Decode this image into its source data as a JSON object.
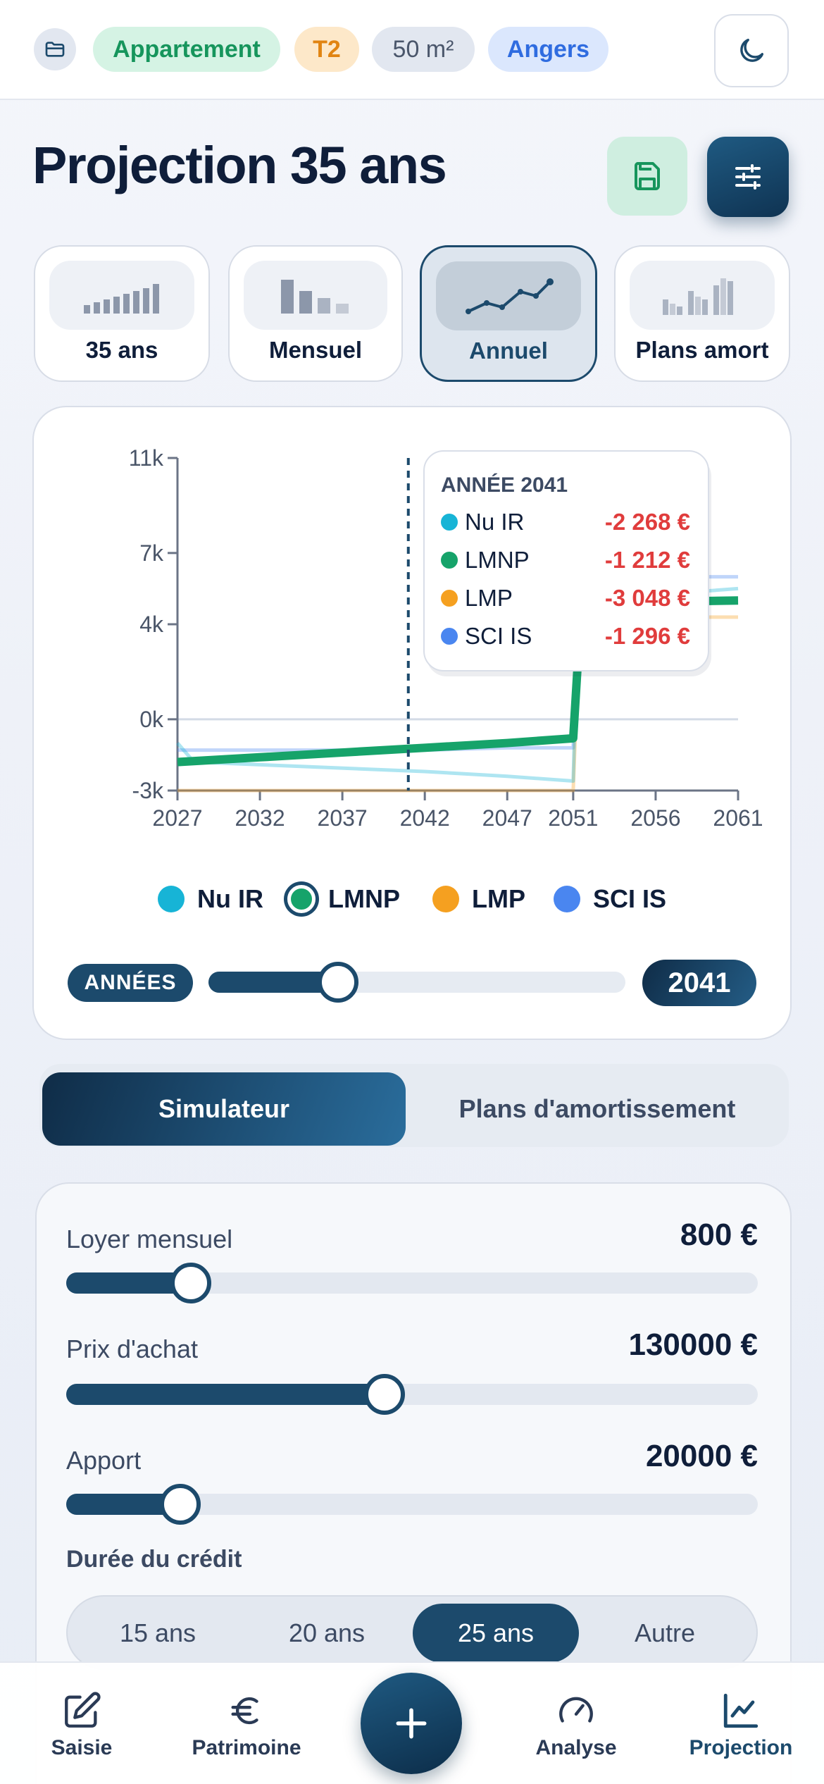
{
  "header": {
    "chips": {
      "type": "Appartement",
      "rooms": "T2",
      "surface": "50 m²",
      "city": "Angers"
    },
    "icons": {
      "folder": "folder-icon",
      "theme": "moon-icon"
    }
  },
  "page": {
    "title": "Projection 35 ans",
    "save_icon": "save-icon",
    "settings_icon": "sliders-icon"
  },
  "view_tabs": [
    {
      "label": "35 ans",
      "active": false
    },
    {
      "label": "Mensuel",
      "active": false
    },
    {
      "label": "Annuel",
      "active": true
    },
    {
      "label": "Plans amort",
      "active": false
    }
  ],
  "chart_data": {
    "type": "line",
    "x": [
      2027,
      2032,
      2037,
      2042,
      2047,
      2051,
      2056,
      2061
    ],
    "xticks": [
      "2027",
      "2032",
      "2037",
      "2042",
      "2047",
      "2051",
      "2056",
      "2061"
    ],
    "yticks": [
      "11k",
      "7k",
      "4k",
      "0k",
      "-3k"
    ],
    "ylim": [
      -3,
      11
    ],
    "xlim": [
      2027,
      2061
    ],
    "marker_year": 2041,
    "series": [
      {
        "name": "Nu IR",
        "color": "#17b4d6",
        "points": [
          [
            2027,
            -1.0
          ],
          [
            2028,
            -1.8
          ],
          [
            2035,
            -2.0
          ],
          [
            2042,
            -2.2
          ],
          [
            2047,
            -2.4
          ],
          [
            2051,
            -2.6
          ],
          [
            2051.3,
            5.0
          ],
          [
            2061,
            5.5
          ]
        ]
      },
      {
        "name": "LMNP",
        "color": "#16a36a",
        "points": [
          [
            2027,
            -1.8
          ],
          [
            2032,
            -1.6
          ],
          [
            2037,
            -1.4
          ],
          [
            2042,
            -1.2
          ],
          [
            2047,
            -1.0
          ],
          [
            2051,
            -0.8
          ],
          [
            2051.5,
            4.9
          ],
          [
            2061,
            5.0
          ]
        ]
      },
      {
        "name": "LMP",
        "color": "#f5a020",
        "points": [
          [
            2027,
            -3.0
          ],
          [
            2032,
            -3.0
          ],
          [
            2037,
            -3.0
          ],
          [
            2042,
            -3.0
          ],
          [
            2047,
            -3.0
          ],
          [
            2051,
            -3.0
          ],
          [
            2051.4,
            4.3
          ],
          [
            2061,
            4.3
          ]
        ]
      },
      {
        "name": "SCI IS",
        "color": "#4a86f0",
        "points": [
          [
            2027,
            -1.3
          ],
          [
            2032,
            -1.3
          ],
          [
            2037,
            -1.3
          ],
          [
            2042,
            -1.3
          ],
          [
            2047,
            -1.2
          ],
          [
            2051,
            -1.2
          ],
          [
            2051.3,
            6.0
          ],
          [
            2061,
            6.0
          ]
        ]
      }
    ],
    "tooltip": {
      "title": "ANNÉE 2041",
      "rows": [
        {
          "name": "Nu IR",
          "value": "-2 268 €",
          "color": "#17b4d6"
        },
        {
          "name": "LMNP",
          "value": "-1 212 €",
          "color": "#16a36a"
        },
        {
          "name": "LMP",
          "value": "-3 048 €",
          "color": "#f5a020"
        },
        {
          "name": "SCI IS",
          "value": "-1 296 €",
          "color": "#4a86f0"
        }
      ],
      "value_color": "#e03c3c"
    },
    "legend": [
      "Nu IR",
      "LMNP",
      "LMP",
      "SCI IS"
    ]
  },
  "years_slider": {
    "label": "ANNÉES",
    "value": "2041",
    "fraction": 0.31
  },
  "segment": {
    "active": "Simulateur",
    "inactive": "Plans d'amortissement"
  },
  "simulator": {
    "rent": {
      "label": "Loyer mensuel",
      "value": "800 €",
      "fraction": 0.18
    },
    "price": {
      "label": "Prix d'achat",
      "value": "130000 €",
      "fraction": 0.46
    },
    "down": {
      "label": "Apport",
      "value": "20000 €",
      "fraction": 0.165
    },
    "duration": {
      "label": "Durée du crédit",
      "options": [
        "15 ans",
        "20 ans",
        "25 ans",
        "Autre"
      ],
      "selected": "25 ans"
    }
  },
  "nav": {
    "items": [
      {
        "label": "Saisie",
        "icon": "edit-icon"
      },
      {
        "label": "Patrimoine",
        "icon": "euro-icon"
      },
      {
        "label": "Analyse",
        "icon": "gauge-icon"
      },
      {
        "label": "Projection",
        "icon": "chart-line-icon"
      }
    ],
    "fab_icon": "plus-icon"
  },
  "colors": {
    "primary": "#1c4a6c",
    "negative": "#e03c3c"
  }
}
